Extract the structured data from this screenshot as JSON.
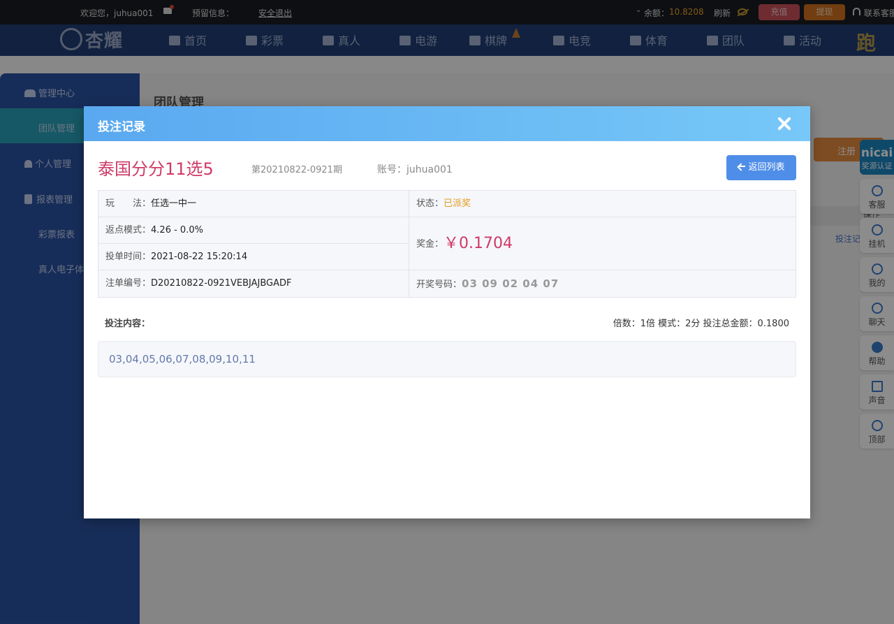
{
  "topbar": {
    "welcome": "欢迎您，juhua001",
    "reserved_info": "预留信息：",
    "logout": "安全退出",
    "balance_label": "余额：",
    "balance_value": "10.8208",
    "refresh": "刷新",
    "recharge": "充值",
    "withdraw": "提现",
    "support": "联系客服"
  },
  "nav": {
    "logo": "杏耀",
    "items": [
      {
        "label": "首页",
        "icon": "home-icon"
      },
      {
        "label": "彩票",
        "icon": "lottery-icon"
      },
      {
        "label": "真人",
        "icon": "live-icon"
      },
      {
        "label": "电游",
        "icon": "slots-icon"
      },
      {
        "label": "棋牌",
        "icon": "cards-icon"
      },
      {
        "label": "电竞",
        "icon": "gamepad-icon"
      },
      {
        "label": "体育",
        "icon": "trophy-icon"
      },
      {
        "label": "团队",
        "icon": "team-icon"
      },
      {
        "label": "活动",
        "icon": "gift-icon"
      }
    ],
    "brand_right": "跑分"
  },
  "sidebar": {
    "mgmt_center": "管理中心",
    "team_mgmt": "团队管理",
    "personal_mgmt": "个人管理",
    "report_mgmt": "报表管理",
    "lottery_report": "彩票报表",
    "live_report": "真人电子体"
  },
  "background": {
    "title": "团队管理",
    "register_btn": "注册",
    "op_header": "操作",
    "bet_link": "投注记"
  },
  "right_tools": {
    "cert_big": "nicai",
    "cert_small": "奖源认证",
    "items": [
      {
        "label": "客服",
        "icon": "headset-icon"
      },
      {
        "label": "挂机",
        "icon": "diamond-icon"
      },
      {
        "label": "我的",
        "icon": "user-icon"
      },
      {
        "label": "聊天",
        "icon": "chat-icon"
      },
      {
        "label": "帮助",
        "icon": "help-icon"
      },
      {
        "label": "声音",
        "icon": "speaker-icon"
      },
      {
        "label": "顶部",
        "icon": "arrow-up-icon"
      }
    ]
  },
  "modal": {
    "title": "投注记录",
    "lottery_name": "泰国分分11选5",
    "period": "第20210822-0921期",
    "account": "账号：juhua001",
    "back_button": "返回列表",
    "play_label": "玩　　法：",
    "play_value": "任选一中一",
    "status_label": "状态：",
    "status_value": "已派奖",
    "rebate_label": "返点模式：",
    "rebate_value": "4.26 - 0.0%",
    "prize_label": "奖金：",
    "prize_value": "￥0.1704",
    "bet_time_label": "投单时间：",
    "bet_time_value": "2021-08-22 15:20:14",
    "order_no_label": "注单编号：",
    "order_no_value": "D20210822-0921VEBJAJBGADF",
    "draw_label": "开奖号码：",
    "draw_value": "03 09 02 04 07",
    "content_label": "投注内容：",
    "summary": "倍数：1倍   模式：2分   投注总金额：0.1800",
    "bet_numbers": "03,04,05,06,07,08,09,10,11"
  }
}
